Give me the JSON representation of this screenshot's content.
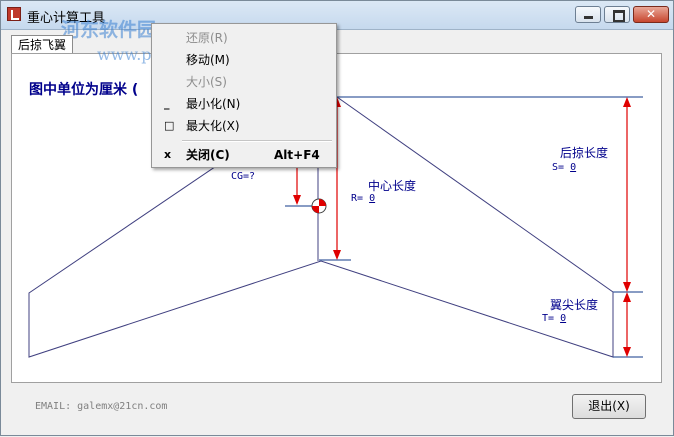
{
  "window": {
    "title": "重心计算工具",
    "watermark": "河东软件园",
    "watermark_url": "www.pc0359.cn"
  },
  "tab": {
    "label": "后掠飞翼"
  },
  "diagram": {
    "units_label": "图中单位为厘米 (",
    "cg_label": "CG=?",
    "center_label": "中心长度",
    "center_var": "R=",
    "center_value": "0",
    "sweep_label": "后掠长度",
    "sweep_var": "S=",
    "sweep_value": "0",
    "tip_label": "翼尖长度",
    "tip_var": "T=",
    "tip_value": "0",
    "line_color": "#404080",
    "dim_color": "#e00000"
  },
  "footer": {
    "email": "EMAIL: galemx@21cn.com",
    "exit_label": "退出(X)"
  },
  "context_menu": {
    "items": [
      {
        "label": "还原(R)",
        "icon": "",
        "shortcut": "",
        "disabled": true
      },
      {
        "label": "移动(M)",
        "icon": "",
        "shortcut": "",
        "disabled": false
      },
      {
        "label": "大小(S)",
        "icon": "",
        "shortcut": "",
        "disabled": true
      },
      {
        "label": "最小化(N)",
        "icon": "_",
        "shortcut": "",
        "disabled": false
      },
      {
        "label": "最大化(X)",
        "icon": "□",
        "shortcut": "",
        "disabled": false
      },
      {
        "label": "关闭(C)",
        "icon": "x",
        "shortcut": "Alt+F4",
        "disabled": false
      }
    ]
  }
}
